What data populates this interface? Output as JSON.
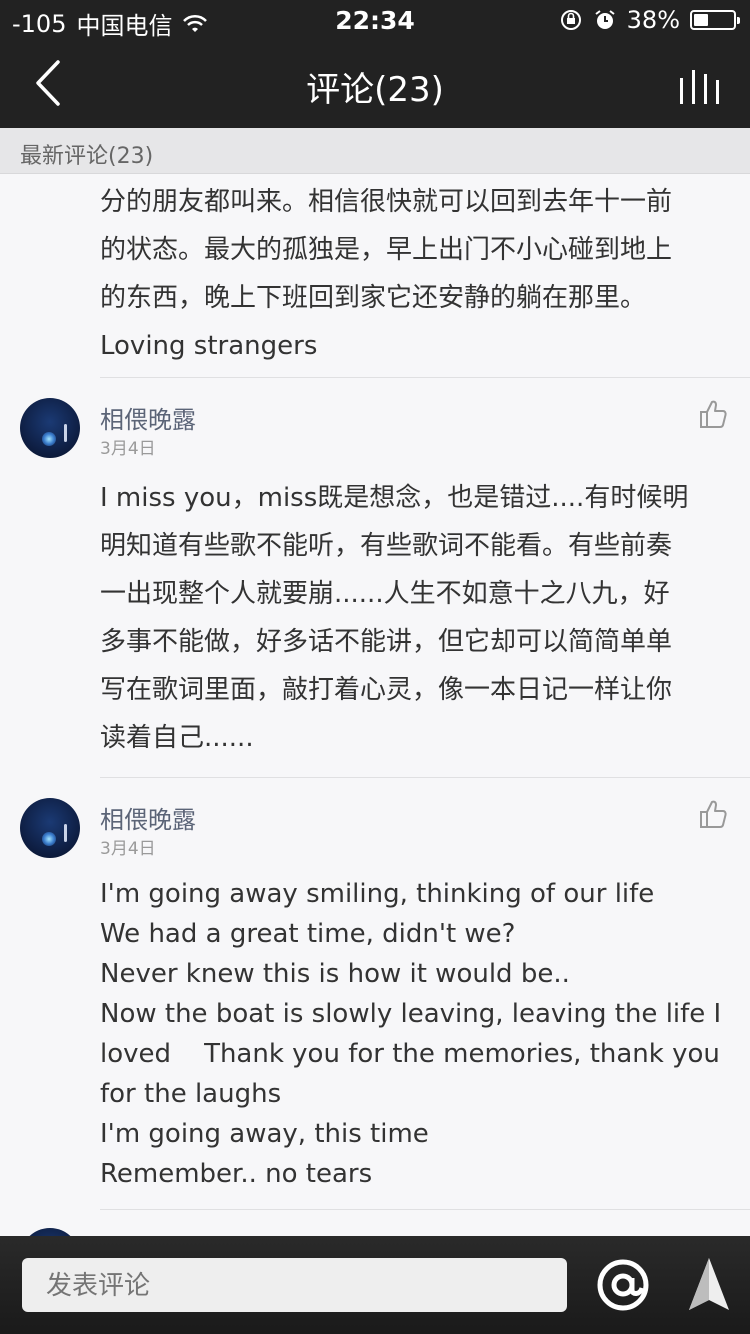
{
  "status_bar": {
    "signal": "-105",
    "carrier": "中国电信",
    "time": "22:34",
    "battery": "38%",
    "battery_level": 0.38
  },
  "nav": {
    "title": "评论(23)"
  },
  "section": {
    "label": "最新评论(23)"
  },
  "comments": [
    {
      "lines": [
        "分的朋友都叫来。相信很快就可以回到去年十一前",
        "的状态。最大的孤独是，早上出门不小心碰到地上",
        "的东西，晚上下班回到家它还安静的躺在那里。",
        "Loving strangers"
      ]
    },
    {
      "username": "相偎晚露",
      "date": "3月4日",
      "lines": [
        "I miss you，miss既是想念，也是错过....有时候明",
        "明知道有些歌不能听，有些歌词不能看。有些前奏",
        "一出现整个人就要崩......人生不如意十之八九，好",
        "多事不能做，好多话不能讲，但它却可以简简单单",
        "写在歌词里面，敲打着心灵，像一本日记一样让你",
        "读着自己......"
      ]
    },
    {
      "username": "相偎晚露",
      "date": "3月4日",
      "lines": [
        "I'm going away smiling, thinking of our life",
        "We had a great time, didn't we?",
        "Never knew this is how it would be..",
        "Now the boat is slowly leaving, leaving the life I",
        "loved    Thank you for the memories, thank you",
        "for the laughs",
        "I'm going away, this time",
        "Remember.. no tears"
      ]
    }
  ],
  "composer": {
    "placeholder": "发表评论"
  },
  "icons": {
    "back": "chevron-left-icon",
    "menu": "equalizer-bars-icon",
    "like": "thumbs-up-icon",
    "mention": "at-sign-icon",
    "send": "send-arrow-icon"
  }
}
